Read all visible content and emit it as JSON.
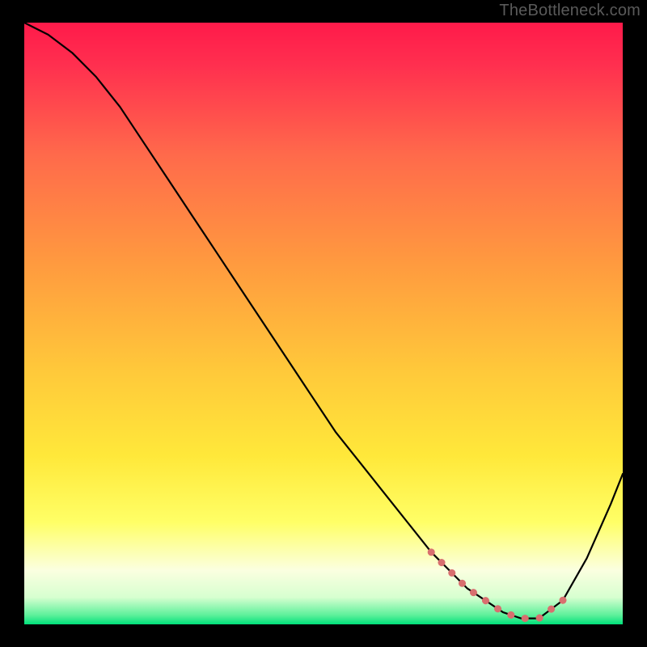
{
  "watermark": "TheBottleneck.com",
  "chart_data": {
    "type": "line",
    "title": "",
    "xlabel": "",
    "ylabel": "",
    "xlim": [
      0,
      100
    ],
    "ylim": [
      0,
      100
    ],
    "background_gradient": {
      "top": "#ff1a4a",
      "upper_mid": "#ff8a3a",
      "mid": "#ffd83a",
      "lower_mid": "#ffff66",
      "near_bottom": "#fbffe0",
      "bottom": "#00e07a"
    },
    "gradient_stops": [
      {
        "pct": 0.0,
        "color": "#ff1a4a"
      },
      {
        "pct": 0.07,
        "color": "#ff2f4f"
      },
      {
        "pct": 0.22,
        "color": "#ff6a4b"
      },
      {
        "pct": 0.4,
        "color": "#ff9a3f"
      },
      {
        "pct": 0.58,
        "color": "#ffc93a"
      },
      {
        "pct": 0.72,
        "color": "#ffe83a"
      },
      {
        "pct": 0.83,
        "color": "#ffff66"
      },
      {
        "pct": 0.91,
        "color": "#fbffe0"
      },
      {
        "pct": 0.955,
        "color": "#d7ffd0"
      },
      {
        "pct": 0.985,
        "color": "#5cf09a"
      },
      {
        "pct": 1.0,
        "color": "#00e07a"
      }
    ],
    "series": [
      {
        "name": "bottleneck-curve",
        "color": "#000000",
        "comment": "x in 0..100 (relative GPU/CPU balance), y in 0..100 (bottleneck %). Values read off the plot; y=0 at bottom green band, y=100 at top.",
        "x": [
          0,
          4,
          8,
          12,
          16,
          20,
          24,
          28,
          32,
          36,
          40,
          44,
          48,
          52,
          56,
          60,
          64,
          68,
          71,
          74,
          77,
          80,
          83,
          86,
          90,
          94,
          98,
          100
        ],
        "y": [
          100,
          98,
          95,
          91,
          86,
          80,
          74,
          68,
          62,
          56,
          50,
          44,
          38,
          32,
          27,
          22,
          17,
          12,
          9,
          6,
          4,
          2,
          1,
          1,
          4,
          11,
          20,
          25
        ]
      }
    ],
    "optimal_range": {
      "comment": "flat minimum region highlighted with dotted coral markers",
      "x_start": 69,
      "x_end": 90,
      "approx_y": 2
    }
  }
}
